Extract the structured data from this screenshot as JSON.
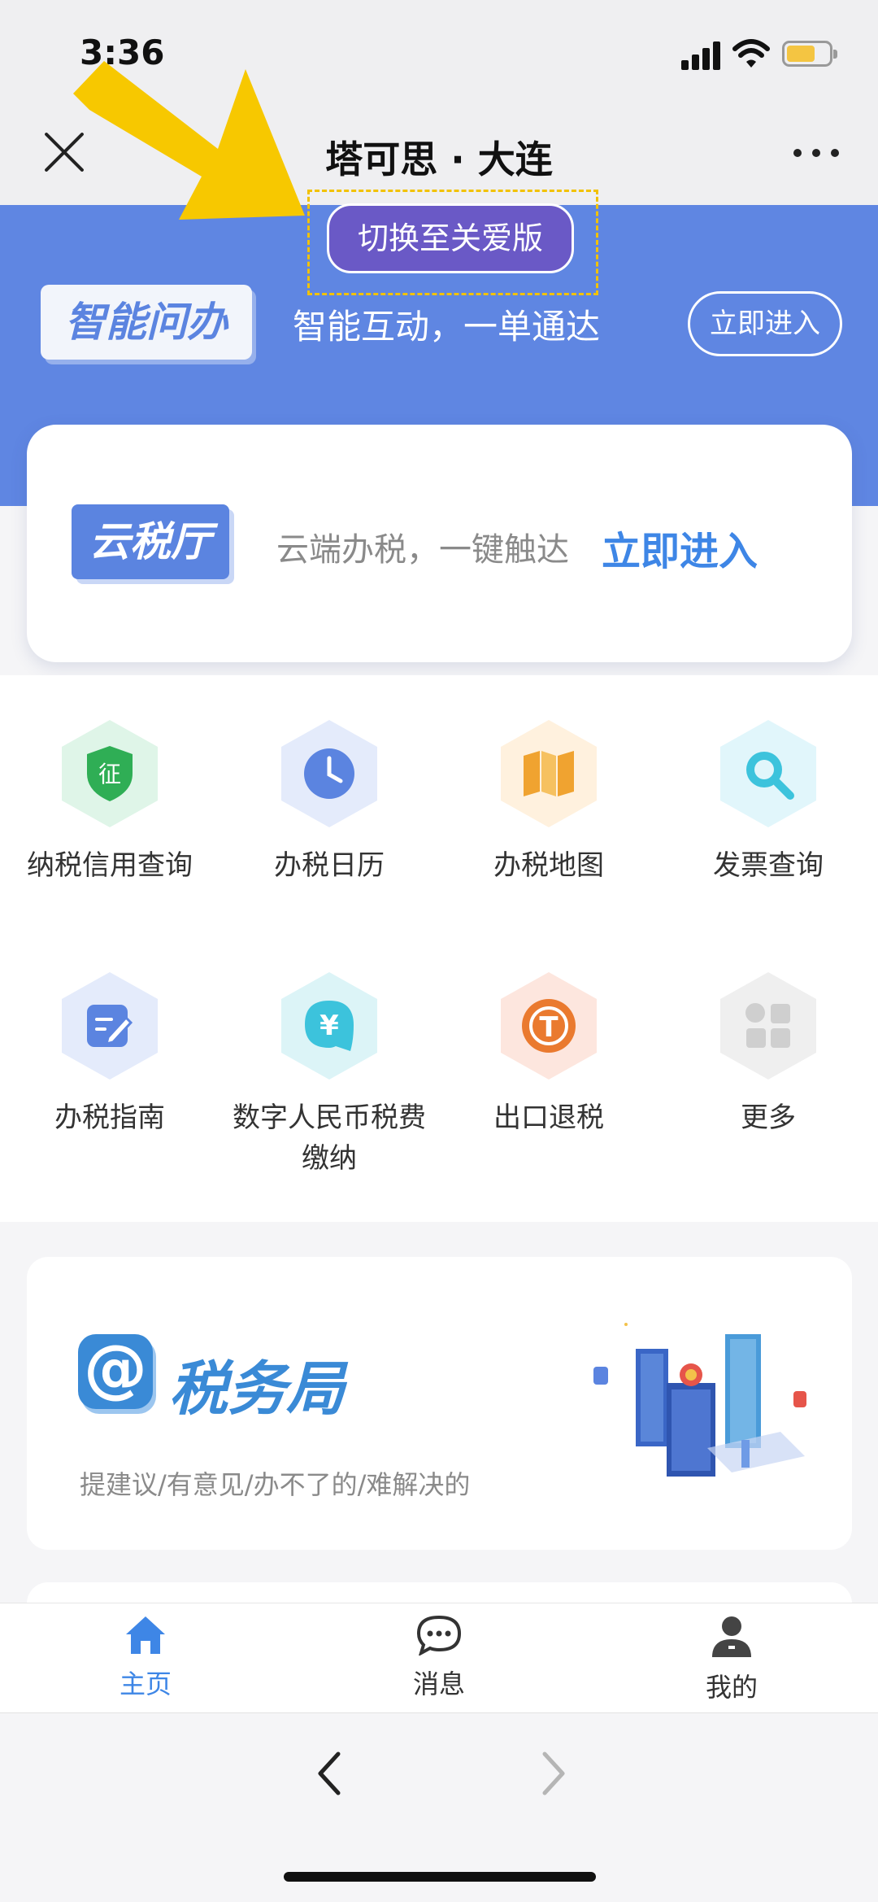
{
  "status_bar": {
    "time": "3:36"
  },
  "nav": {
    "title": "塔可思 · 大连"
  },
  "header": {
    "care_button": "切换至关爱版",
    "smart_badge": "智能问办",
    "smart_slogan": "智能互动，一单通达",
    "enter_button": "立即进入"
  },
  "cloud_card": {
    "badge": "云税厅",
    "slogan": "云端办税，一键触达",
    "enter_link": "立即进入"
  },
  "services": [
    {
      "label": "纳税信用查询",
      "icon": "credit-shield-icon"
    },
    {
      "label": "办税日历",
      "icon": "clock-icon"
    },
    {
      "label": "办税地图",
      "icon": "map-icon"
    },
    {
      "label": "发票查询",
      "icon": "magnifier-icon"
    },
    {
      "label": "办税指南",
      "icon": "edit-note-icon"
    },
    {
      "label": "数字人民币税费缴纳",
      "icon": "yuan-chat-icon"
    },
    {
      "label": "出口退税",
      "icon": "refund-icon"
    },
    {
      "label": "更多",
      "icon": "grid-icon"
    }
  ],
  "shield_char": "征",
  "yuan_char": "¥",
  "refund_char": "T",
  "bureau_card": {
    "at": "@",
    "title": "税务局",
    "subtitle": "提建议/有意见/办不了的/难解决的"
  },
  "tab_bar": [
    {
      "label": "主页",
      "active": true,
      "icon": "home-icon"
    },
    {
      "label": "消息",
      "active": false,
      "icon": "chat-bubble-icon"
    },
    {
      "label": "我的",
      "active": false,
      "icon": "user-icon"
    }
  ],
  "colors": {
    "header_blue": "#5f86e2",
    "care_purple": "#6a59c6",
    "accent_blue": "#3e86e6",
    "tab_active": "#3e86e6",
    "tab_inactive": "#333333"
  }
}
